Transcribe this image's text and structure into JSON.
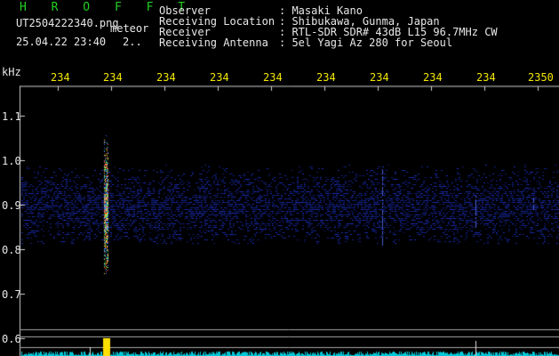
{
  "header": {
    "app_title": "H R O F F T",
    "filename": "UT2504222340.png",
    "type_label": "meteor",
    "datetime": "25.04.22 23:40",
    "extra": "2..",
    "info_labels": [
      "Observer",
      "Receiving Location",
      "Receiver",
      "Receiving Antenna"
    ],
    "info_values": [
      ": Masaki Kano",
      ": Shibukawa, Gunma, Japan",
      ": RTL-SDR SDR# 43dB L15 96.7MHz CW",
      ": 5el Yagi Az 280 for Seoul"
    ]
  },
  "axes": {
    "y_unit": "kHz",
    "y_ticks": [
      "1.1",
      "1.0",
      "0.9",
      "0.8",
      "0.7",
      "0.6"
    ],
    "x_ticks": [
      "234",
      "234",
      "234",
      "234",
      "234",
      "234",
      "234",
      "234",
      "234",
      "2350"
    ]
  },
  "colors": {
    "background": "#000000",
    "header_text": "#e8e8e8",
    "tick_text": "#f2e600",
    "title_text": "#21d021",
    "noise": "#1e2aa0",
    "baseline": "#00c8d8"
  }
}
